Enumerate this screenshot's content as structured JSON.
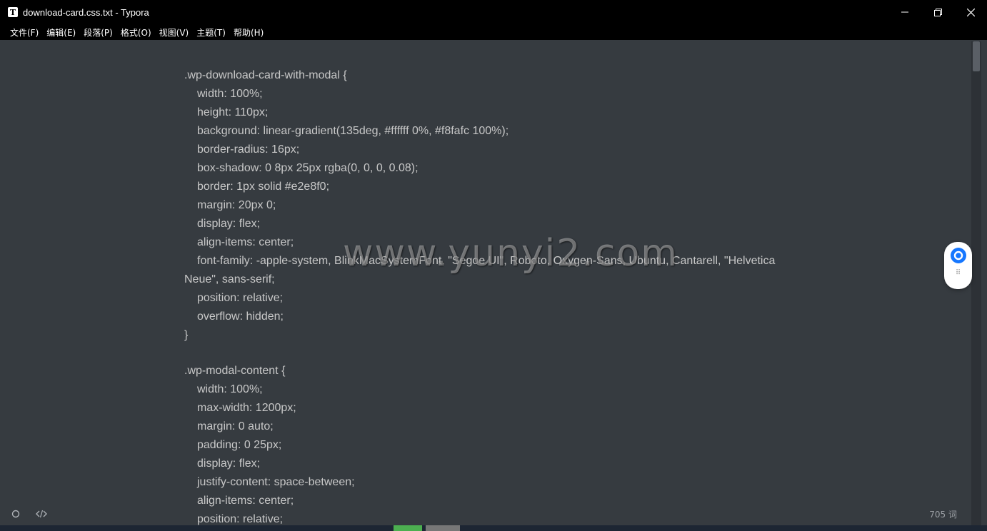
{
  "window": {
    "app_icon_letter": "T",
    "title": "download-card.css.txt - Typora"
  },
  "menu": [
    "文件(F)",
    "编辑(E)",
    "段落(P)",
    "格式(O)",
    "视图(V)",
    "主题(T)",
    "帮助(H)"
  ],
  "code_lines": [
    ".wp-download-card-with-modal {",
    "width: 100%;",
    "height: 110px;",
    "background: linear-gradient(135deg, #ffffff 0%, #f8fafc 100%);",
    "border-radius: 16px;",
    "box-shadow: 0 8px 25px rgba(0, 0, 0, 0.08);",
    "border: 1px solid #e2e8f0;",
    "margin: 20px 0;",
    "display: flex;",
    "align-items: center;",
    "font-family: -apple-system, BlinkMacSystemFont, \"Segoe UI\", Roboto, Oxygen-Sans, Ubuntu, Cantarell, \"Helvetica",
    "Neue\", sans-serif;",
    "position: relative;",
    "overflow: hidden;",
    "}",
    ".wp-modal-content {",
    "width: 100%;",
    "max-width: 1200px;",
    "margin: 0 auto;",
    "padding: 0 25px;",
    "display: flex;",
    "justify-content: space-between;",
    "align-items: center;",
    "position: relative;"
  ],
  "watermark": "www.yunyi2.com",
  "status": {
    "word_count": "705 词"
  }
}
